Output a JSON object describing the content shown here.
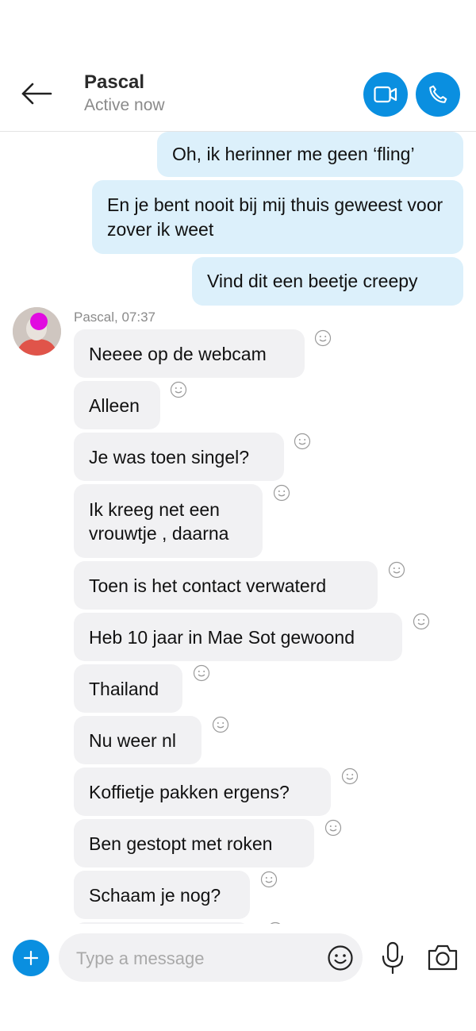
{
  "header": {
    "contact_name": "Pascal",
    "status": "Active now",
    "accent_color": "#0a8fe0"
  },
  "outgoing": [
    {
      "text": "Oh, ik herinner me geen ‘fling’"
    },
    {
      "text": "En je bent nooit bij mij thuis geweest voor zover ik weet"
    },
    {
      "text": "Vind dit een beetje creepy"
    }
  ],
  "incoming": {
    "sender_meta": "Pascal, 07:37",
    "messages": [
      {
        "text": "Neeee op de webcam"
      },
      {
        "text": "Alleen"
      },
      {
        "text": "Je was toen singel?"
      },
      {
        "text": "Ik kreeg net een vrouwtje , daarna"
      },
      {
        "text": "Toen is het contact verwaterd"
      },
      {
        "text": "Heb 10 jaar in Mae Sot gewoond"
      },
      {
        "text": "Thailand"
      },
      {
        "text": "Nu weer nl"
      },
      {
        "text": "Koffietje pakken ergens?"
      },
      {
        "text": "Ben gestopt met roken"
      },
      {
        "text": "Schaam je nog?"
      }
    ]
  },
  "composer": {
    "placeholder": "Type a message"
  },
  "icons": {
    "back": "back-arrow-icon",
    "video": "video-camera-icon",
    "call": "phone-icon",
    "reaction": "smiley-reaction-icon",
    "add": "plus-icon",
    "emoji": "emoji-icon",
    "mic": "microphone-icon",
    "camera": "camera-icon"
  }
}
